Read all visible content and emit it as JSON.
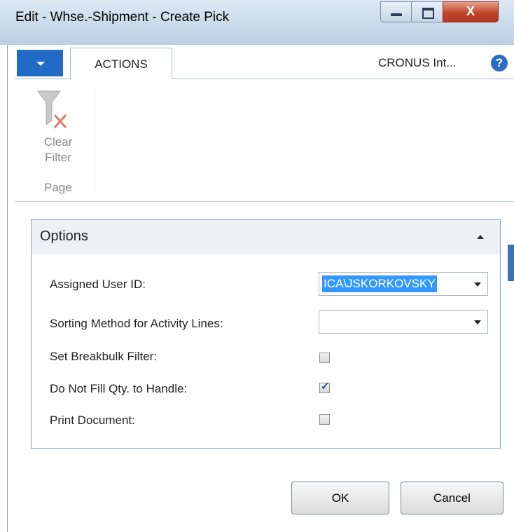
{
  "window": {
    "title": "Edit - Whse.-Shipment - Create Pick",
    "close_glyph": "X"
  },
  "ribbon": {
    "tab_actions": "ACTIONS",
    "company": "CRONUS Int...",
    "help_glyph": "?",
    "clear_filter_line1": "Clear",
    "clear_filter_line2": "Filter",
    "group_label": "Page"
  },
  "options": {
    "title": "Options",
    "fields": {
      "assigned_user_label": "Assigned User ID:",
      "assigned_user_value": "ICA\\JSKORKOVSKY",
      "sorting_label": "Sorting Method for Activity Lines:",
      "sorting_value": "",
      "breakbulk_label": "Set Breakbulk Filter:",
      "breakbulk_checked": false,
      "donotfill_label": "Do Not Fill Qty. to Handle:",
      "donotfill_checked": true,
      "print_label": "Print Document:",
      "print_checked": false
    }
  },
  "buttons": {
    "ok": "OK",
    "cancel": "Cancel"
  },
  "colors": {
    "accent": "#1f6bc5",
    "selection": "#3399ff",
    "close_button": "#c0452c"
  }
}
